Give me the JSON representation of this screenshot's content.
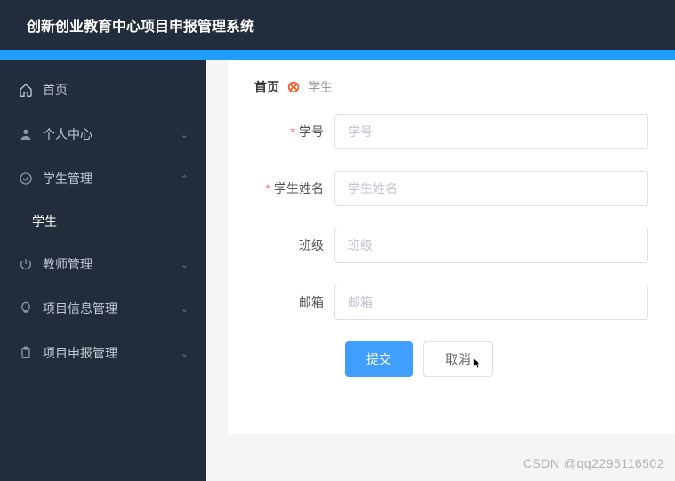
{
  "header": {
    "title": "创新创业教育中心项目申报管理系统"
  },
  "sidebar": {
    "items": [
      {
        "label": "首页",
        "icon": "home-icon",
        "has_children": false
      },
      {
        "label": "个人中心",
        "icon": "user-icon",
        "has_children": true,
        "expanded": false
      },
      {
        "label": "学生管理",
        "icon": "circle-check-icon",
        "has_children": true,
        "expanded": true
      },
      {
        "label": "教师管理",
        "icon": "power-icon",
        "has_children": true,
        "expanded": false
      },
      {
        "label": "项目信息管理",
        "icon": "bulb-icon",
        "has_children": true,
        "expanded": false
      },
      {
        "label": "项目申报管理",
        "icon": "clipboard-icon",
        "has_children": true,
        "expanded": false
      }
    ],
    "sub_student": "学生"
  },
  "breadcrumb": {
    "home": "首页",
    "current": "学生"
  },
  "form": {
    "student_no": {
      "label": "学号",
      "placeholder": "学号",
      "required": true
    },
    "student_name": {
      "label": "学生姓名",
      "placeholder": "学生姓名",
      "required": true
    },
    "class": {
      "label": "班级",
      "placeholder": "班级",
      "required": false
    },
    "email": {
      "label": "邮箱",
      "placeholder": "邮箱",
      "required": false
    }
  },
  "buttons": {
    "submit": "提交",
    "cancel": "取消"
  },
  "watermark": "CSDN @qq2295116502"
}
